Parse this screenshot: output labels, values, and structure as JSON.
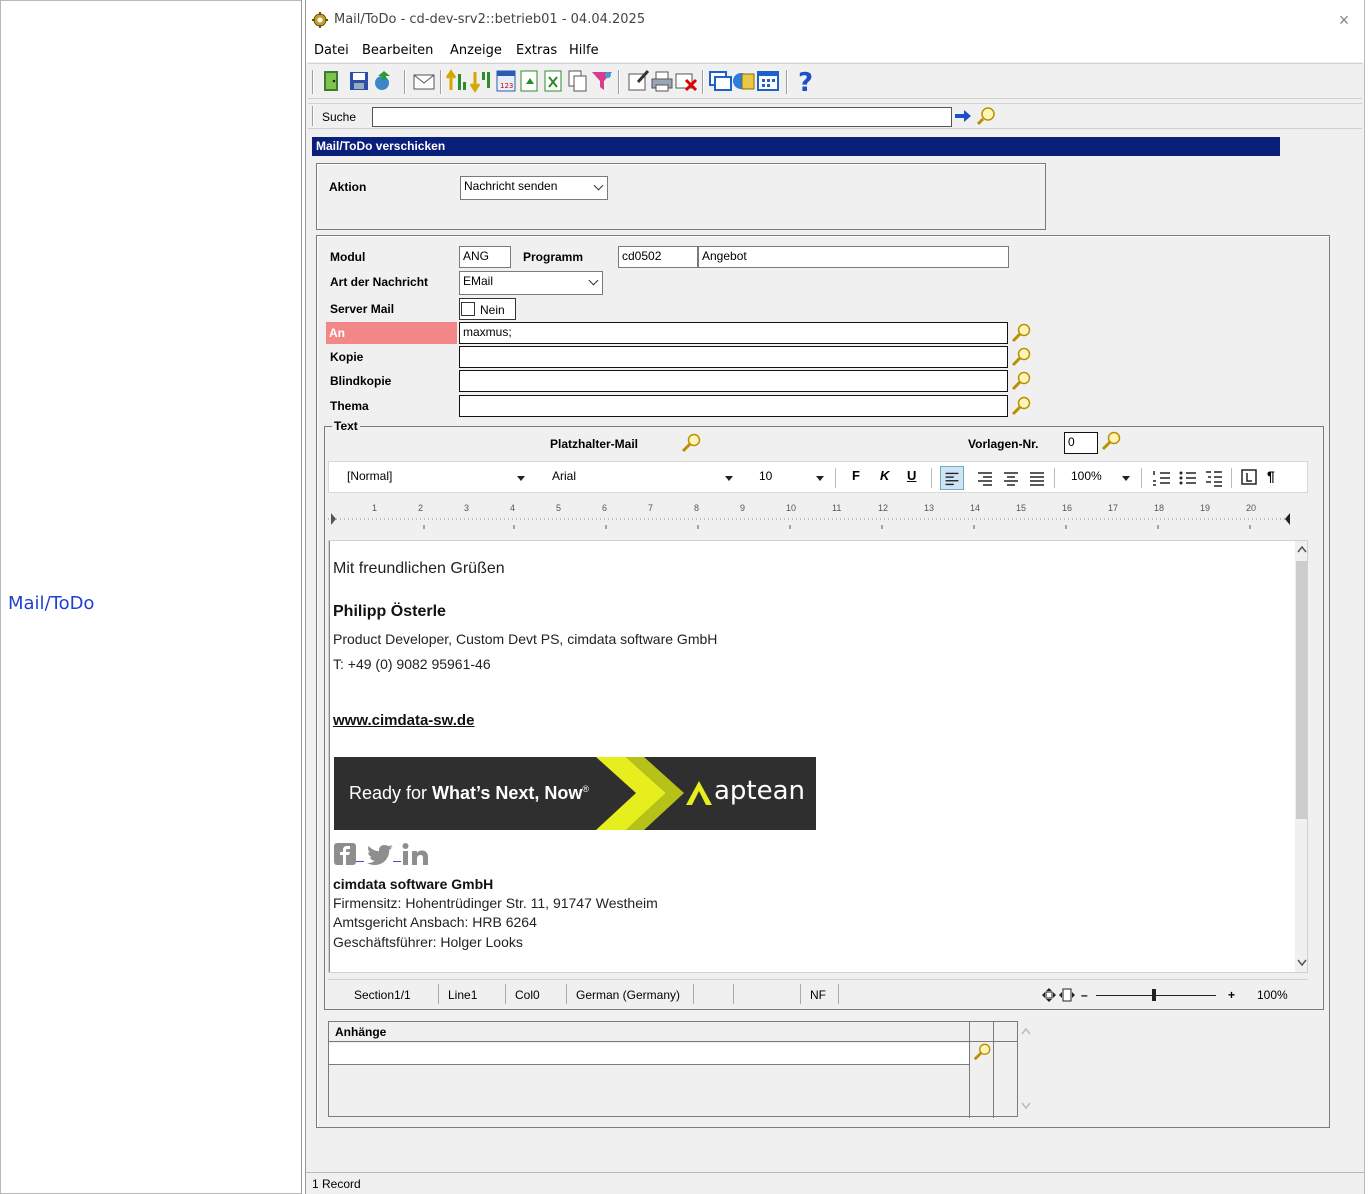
{
  "wiki": {
    "link_label": "Mail/ToDo"
  },
  "window": {
    "title": "Mail/ToDo - cd-dev-srv2::betrieb01 - 04.04.2025",
    "close": "×"
  },
  "menu": [
    {
      "label": "Datei"
    },
    {
      "label": "Bearbeiten"
    },
    {
      "label": "Anzeige"
    },
    {
      "label": "Extras"
    },
    {
      "label": "Hilfe"
    }
  ],
  "search": {
    "label": "Suche",
    "value": ""
  },
  "section": {
    "header": "Mail/ToDo verschicken"
  },
  "aktion": {
    "label": "Aktion",
    "value": "Nachricht senden"
  },
  "form": {
    "modul_label": "Modul",
    "modul_value": "ANG",
    "programm_label": "Programm",
    "programm_code": "cd0502",
    "programm_name": "Angebot",
    "art_label": "Art der Nachricht",
    "art_value": "EMail",
    "server_label": "Server Mail",
    "server_value": "Nein",
    "an_label": "An",
    "an_value": "maxmus;",
    "kopie_label": "Kopie",
    "kopie_value": "",
    "blind_label": "Blindkopie",
    "blind_value": "",
    "thema_label": "Thema",
    "thema_value": ""
  },
  "text": {
    "legend": "Text",
    "platzhalter_label": "Platzhalter-Mail",
    "vorlagen_label": "Vorlagen-Nr.",
    "vorlagen_value": "0"
  },
  "format": {
    "style": "[Normal]",
    "font": "Arial",
    "size": "10",
    "bold": "F",
    "italic": "K",
    "underline": "U",
    "zoom": "100%"
  },
  "ruler": {
    "marks": [
      "1",
      "2",
      "3",
      "4",
      "5",
      "6",
      "7",
      "8",
      "9",
      "10",
      "11",
      "12",
      "13",
      "14",
      "15",
      "16",
      "17",
      "18",
      "19",
      "20"
    ]
  },
  "editor": {
    "greeting": "Mit freundlichen Grüßen",
    "name": "Philipp Österle",
    "role": "Product Developer, Custom Devt PS, cimdata software GmbH",
    "phone": "T: +49 (0) 9082 95961-46",
    "website": "www.cimdata-sw.de",
    "banner_text_1": "Ready for ",
    "banner_text_2": "What’s Next, Now",
    "banner_reg": "®",
    "banner_brand": "aptean",
    "company": "cimdata software GmbH",
    "address": "Firmensitz: Hohentrüdinger Str. 11, 91747 Westheim",
    "court": "Amtsgericht Ansbach: HRB 6264",
    "ceo": "Geschäftsführer: Holger Looks"
  },
  "editor_status": {
    "section": "Section1/1",
    "line": "Line1",
    "col": "Col0",
    "lang": "German (Germany)",
    "nf": "NF",
    "zoom": "100%",
    "minus": "–",
    "plus": "+"
  },
  "attachments": {
    "header": "Anhänge"
  },
  "status": {
    "records": "1 Record"
  },
  "colors": {
    "header_bg": "#0a1f7a",
    "required_bg": "#f38787",
    "link": "#1f3fd0"
  },
  "icons": [
    "gear-icon",
    "exit-icon",
    "save-icon",
    "recycle-icon",
    "mail-icon",
    "sort-asc-icon",
    "sort-desc-icon",
    "calendar-icon",
    "export-icon",
    "excel-icon",
    "copy-icon",
    "filter-icon",
    "edit-icon",
    "print-icon",
    "delete-icon",
    "window-icon",
    "book-icon",
    "table-icon",
    "help-icon",
    "search-icon",
    "arrow-right-icon",
    "magnifier-icon"
  ]
}
